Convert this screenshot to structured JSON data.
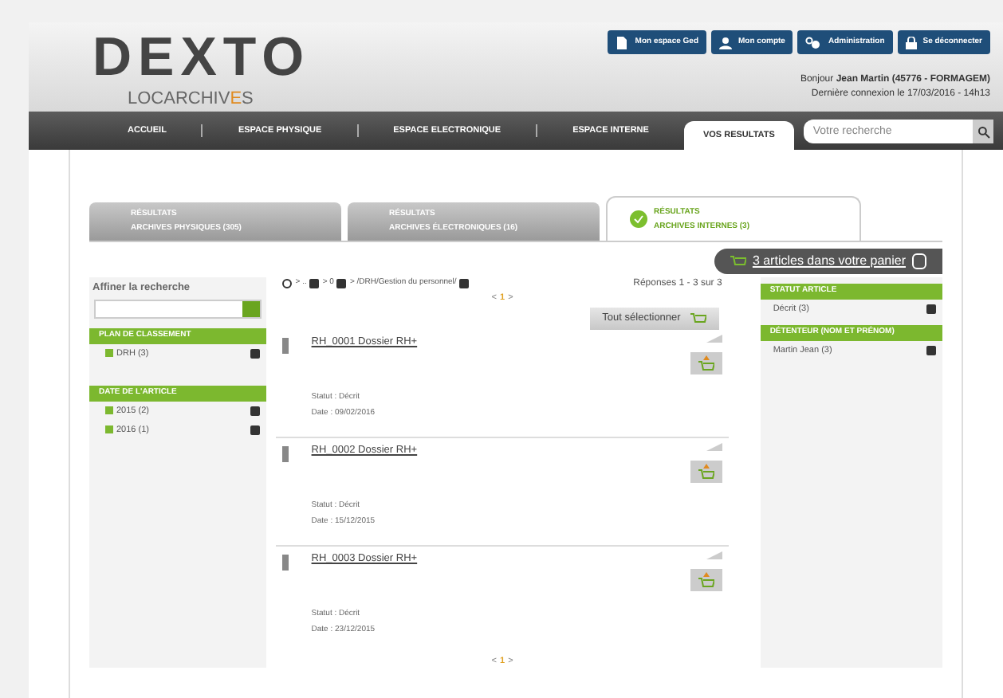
{
  "logo": {
    "name": "DEXTO",
    "subtitle_start": "LOCARCHIV",
    "subtitle_accent": "E",
    "subtitle_end": "S"
  },
  "header_buttons": [
    {
      "kind": "ged",
      "label": "Mon espace Ged"
    },
    {
      "kind": "account",
      "label": "Mon compte"
    },
    {
      "kind": "admin",
      "label": "Administration"
    },
    {
      "kind": "logout",
      "label": "Se déconnecter"
    }
  ],
  "greeting": "Bonjour **Jean Martin (45776 - FORMAGEM)**",
  "last_login": "Dernière connexion le 17/03/2016 - 14h13",
  "nav": [
    {
      "label": "ACCUEIL",
      "selected": false
    },
    {
      "label": "ESPACE PHYSIQUE",
      "selected": false
    },
    {
      "label": "ESPACE ELECTRONIQUE",
      "selected": false
    },
    {
      "label": "ESPACE INTERNE",
      "selected": false
    },
    {
      "label": "VOS RESULTATS",
      "selected": true
    }
  ],
  "search": {
    "placeholder": "Votre recherche"
  },
  "result_tabs": [
    {
      "line1": "RÉSULTATS",
      "line2": "ARCHIVES PHYSIQUES (305)",
      "selected": false
    },
    {
      "line1": "RÉSULTATS",
      "line2": "ARCHIVES ÉLECTRONIQUES (16)",
      "selected": false
    },
    {
      "line1": "RÉSULTATS",
      "line2": "ARCHIVES INTERNES (3)",
      "selected": true
    }
  ],
  "cart": {
    "label": "3 articles dans votre panier"
  },
  "refine": {
    "title": "Affiner la recherche",
    "groups": [
      {
        "title": "PLAN DE CLASSEMENT",
        "items": [
          "DRH (3)"
        ]
      },
      {
        "title": "DATE DE L'ARTICLE",
        "items": [
          "2015 (2)",
          "2016 (1)"
        ]
      }
    ]
  },
  "breadcrumb": [
    "> ..",
    "> 0",
    "> /DRH/Gestion du personnel/"
  ],
  "answers": "Réponses 1 - 3 sur 3",
  "pager_top": {
    "prev": "<",
    "page": "1",
    "next": ">"
  },
  "select_all": "Tout sélectionner",
  "results": [
    {
      "title": "RH_0001 Dossier RH+",
      "status": "Statut : Décrit",
      "date": "Date : 09/02/2016"
    },
    {
      "title": "RH_0002 Dossier RH+",
      "status": "Statut : Décrit",
      "date": "Date : 15/12/2015"
    },
    {
      "title": "RH_0003 Dossier RH+",
      "status": "Statut : Décrit",
      "date": "Date : 23/12/2015"
    }
  ],
  "pager_bottom": {
    "prev": "<",
    "page": "1",
    "next": ">"
  },
  "facets": [
    {
      "title": "STATUT ARTICLE",
      "items": [
        "Décrit (3)"
      ]
    },
    {
      "title": "DÉTENTEUR (NOM ET PRÉNOM)",
      "items": [
        "Martin Jean (3)"
      ]
    }
  ]
}
